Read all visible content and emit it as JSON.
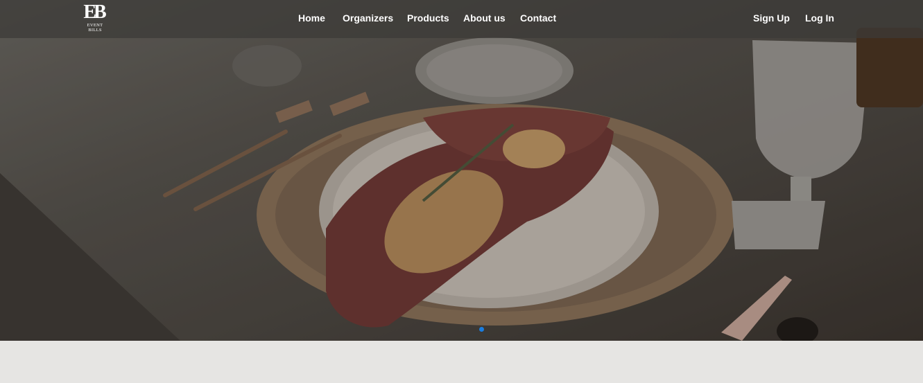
{
  "brand": {
    "logo_mark": "EB",
    "logo_line1": "EVENT",
    "logo_line2": "BILLS"
  },
  "nav": {
    "items": [
      {
        "label": "Home"
      },
      {
        "label": "Organizers"
      },
      {
        "label": "Products"
      },
      {
        "label": "About us"
      },
      {
        "label": "Contact"
      }
    ],
    "auth": [
      {
        "label": "Sign Up"
      },
      {
        "label": "Log In"
      }
    ]
  },
  "hero": {
    "slide_count": 1,
    "active_slide": 1,
    "indicator_color": "#1a7de0"
  },
  "colors": {
    "navbar": "#3c3a38",
    "page_background": "#e6e5e3",
    "nav_text": "#ffffff"
  }
}
